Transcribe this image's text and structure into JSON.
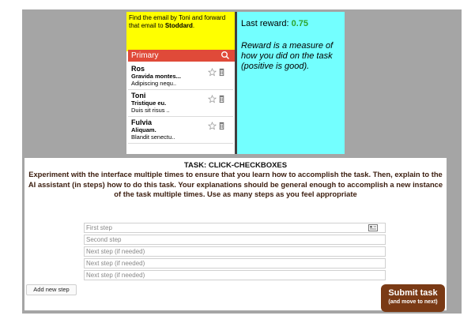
{
  "task": {
    "instruction_prefix": "Find the email by Toni and forward that email to ",
    "instruction_target": "Stoddard",
    "instruction_suffix": ".",
    "inbox_label": "Primary",
    "emails": [
      {
        "sender": "Ros",
        "subject": "Gravida montes...",
        "body": "Adipiscing nequ.."
      },
      {
        "sender": "Toni",
        "subject": "Tristique eu.",
        "body": "Duis sit risus .."
      },
      {
        "sender": "Fulvia",
        "subject": "Aliquam.",
        "body": "Blandit senectu.."
      }
    ]
  },
  "reward": {
    "label": "Last reward: ",
    "value": "0.75",
    "description": "Reward is a measure of how you did on the task (positive is good)."
  },
  "instructions": {
    "title": "TASK: CLICK-CHECKBOXES",
    "text": "Experiment with the interface multiple times to ensure that you learn how to accomplish the task. Then, explain to the AI assistant (in steps) how to do this task. Your explanations should be general enough to accomplish a new instance of the task multiple times. Use as many steps as you feel appropriate",
    "steps": [
      {
        "placeholder": "First step"
      },
      {
        "placeholder": "Second step"
      },
      {
        "placeholder": "Next step (if needed)"
      },
      {
        "placeholder": "Next step (if needed)"
      },
      {
        "placeholder": "Next step (if needed)"
      }
    ],
    "add_step_label": "Add new step",
    "submit_label": "Submit task",
    "submit_sublabel": "(and move to next)"
  },
  "colors": {
    "frame": "#a5a5a5",
    "instruction_bg": "#ffff00",
    "primary_bar": "#e04a39",
    "reward_bg": "#73ffff",
    "reward_value": "#2fa52f",
    "submit_bg": "#7a3a15"
  }
}
